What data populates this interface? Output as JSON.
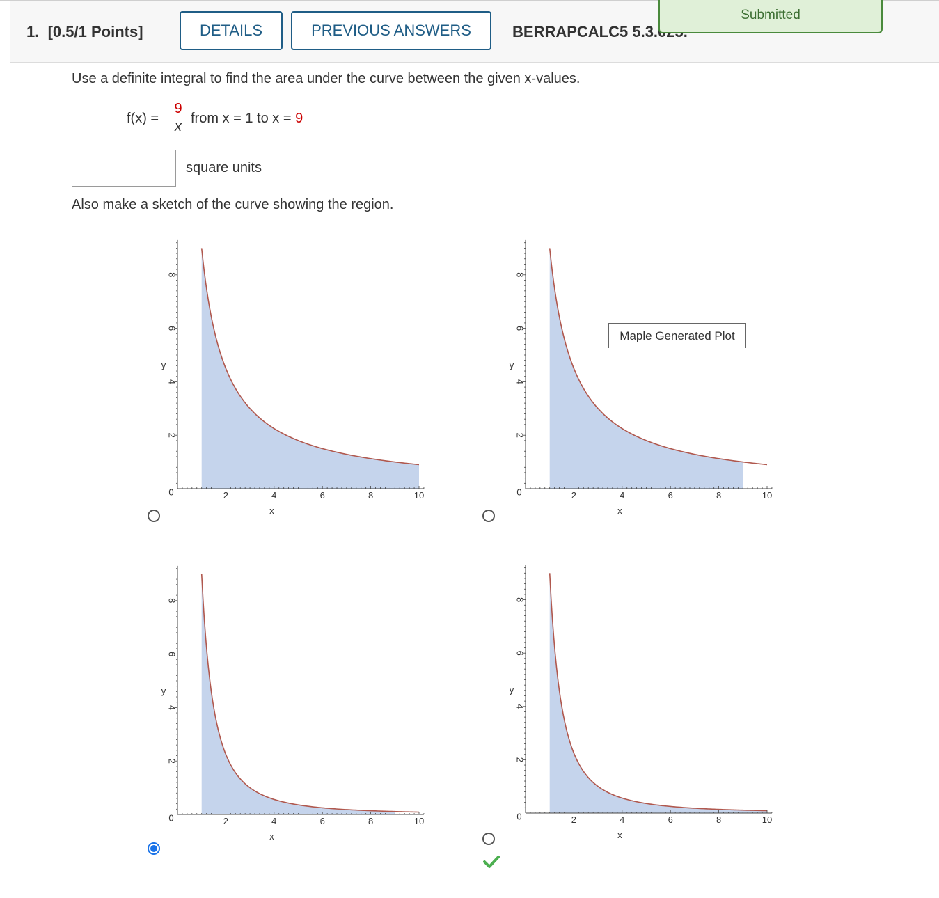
{
  "header": {
    "question_number": "1.",
    "points": "[0.5/1 Points]",
    "details_label": "DETAILS",
    "previous_answers_label": "PREVIOUS ANSWERS",
    "problem_code": "BERRAPCALC5 5.3.025.",
    "status": "Submitted"
  },
  "question": {
    "prompt": "Use a definite integral to find the area under the curve between the given x-values.",
    "function_lhs": "f(x) =",
    "numerator": "9",
    "denominator": "x",
    "range_from": "from x = 1 to x =",
    "upper_limit": "9",
    "answer_value": "",
    "units": "square units",
    "sketch_instruction": "Also make a sketch of the curve showing the region."
  },
  "tooltip": "Maple Generated Plot",
  "options": [
    {
      "selected": false,
      "correct": false
    },
    {
      "selected": false,
      "correct": false
    },
    {
      "selected": true,
      "correct": false
    },
    {
      "selected": false,
      "correct": true
    }
  ],
  "chart_data": [
    {
      "type": "area",
      "function": "f(x) = 9/x",
      "xlabel": "x",
      "ylabel": "y",
      "xlim": [
        0,
        10
      ],
      "ylim": [
        0,
        9.3
      ],
      "curve_domain": [
        1,
        10
      ],
      "shade_domain": [
        1,
        10
      ],
      "xticks": [
        "2",
        "4",
        "6",
        "8",
        "10"
      ],
      "yticks": [
        "0",
        "2",
        "4",
        "6",
        "8"
      ],
      "colors": {
        "fill": "#c5d4ec",
        "curve": "#b0584e"
      }
    },
    {
      "type": "area",
      "function": "f(x) = 9/x",
      "xlabel": "x",
      "ylabel": "y",
      "xlim": [
        0,
        10
      ],
      "ylim": [
        0,
        9.3
      ],
      "curve_domain": [
        1,
        10
      ],
      "shade_domain": [
        1,
        9
      ],
      "xticks": [
        "2",
        "4",
        "6",
        "8",
        "10"
      ],
      "yticks": [
        "0",
        "2",
        "4",
        "6",
        "8"
      ],
      "colors": {
        "fill": "#c5d4ec",
        "curve": "#b0584e"
      }
    },
    {
      "type": "area",
      "function": "f(x) = 9/x^2",
      "xlabel": "x",
      "ylabel": "y",
      "xlim": [
        0,
        10
      ],
      "ylim": [
        0,
        9.3
      ],
      "curve_domain": [
        1,
        10
      ],
      "shade_domain": [
        1,
        9
      ],
      "xticks": [
        "2",
        "4",
        "6",
        "8",
        "10"
      ],
      "yticks": [
        "0",
        "2",
        "4",
        "6",
        "8"
      ],
      "colors": {
        "fill": "#c5d4ec",
        "curve": "#b0584e"
      }
    },
    {
      "type": "area",
      "function": "f(x) = 9/x^2",
      "xlabel": "x",
      "ylabel": "y",
      "xlim": [
        0,
        10
      ],
      "ylim": [
        0,
        9.3
      ],
      "curve_domain": [
        1,
        10
      ],
      "shade_domain": [
        1,
        10
      ],
      "xticks": [
        "2",
        "4",
        "6",
        "8",
        "10"
      ],
      "yticks": [
        "0",
        "2",
        "4",
        "6",
        "8"
      ],
      "colors": {
        "fill": "#c5d4ec",
        "curve": "#b0584e"
      }
    }
  ]
}
